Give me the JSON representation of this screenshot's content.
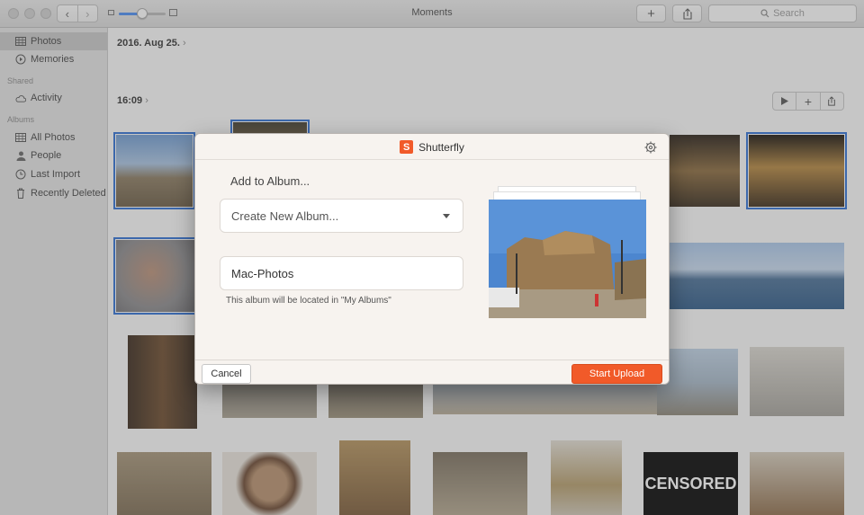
{
  "window": {
    "title": "Moments"
  },
  "toolbar": {
    "search_placeholder": "Search",
    "zoom_level": 0.5
  },
  "sidebar": {
    "items": [
      {
        "label": "Photos",
        "icon": "photos-icon",
        "selected": true
      },
      {
        "label": "Memories",
        "icon": "memories-icon"
      }
    ],
    "shared_heading": "Shared",
    "shared_items": [
      {
        "label": "Activity",
        "icon": "cloud-icon"
      }
    ],
    "albums_heading": "Albums",
    "album_items": [
      {
        "label": "All Photos",
        "icon": "photos-icon"
      },
      {
        "label": "People",
        "icon": "person-icon"
      },
      {
        "label": "Last Import",
        "icon": "clock-icon"
      },
      {
        "label": "Recently Deleted",
        "icon": "trash-icon"
      }
    ]
  },
  "main": {
    "date_header": "2016. Aug 25.",
    "time_header": "16:09",
    "censored_label": "CENSORED"
  },
  "dialog": {
    "title": "Shutterfly",
    "logo_letter": "S",
    "heading": "Add to Album...",
    "album_select": "Create New Album...",
    "album_name": "Mac-Photos",
    "note": "This album will be located in \"My Albums\"",
    "cancel_label": "Cancel",
    "upload_label": "Start Upload",
    "accent": "#f15a29"
  }
}
